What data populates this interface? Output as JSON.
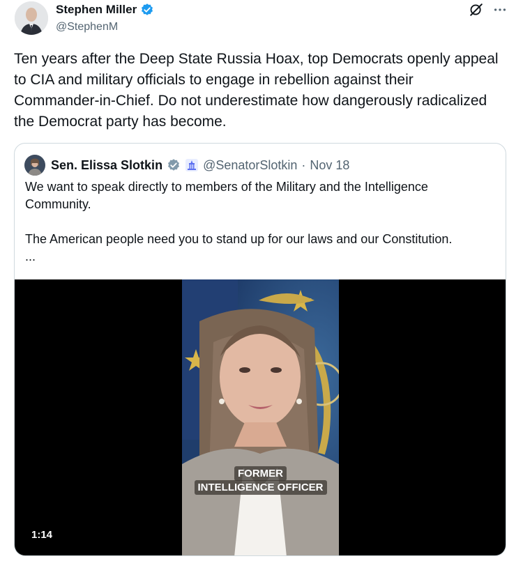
{
  "author": {
    "name": "Stephen Miller",
    "handle": "@StephenM",
    "verified": true,
    "verified_color": "#1d9bf0"
  },
  "header_icons": [
    "grok-icon",
    "more-icon"
  ],
  "post": {
    "text": "Ten years after the Deep State Russia Hoax, top Democrats openly appeal to CIA and military officials to engage in rebellion against their Commander-in-Chief. Do not underestimate how dangerously radicalized the Democrat party has become."
  },
  "quoted_post": {
    "name": "Sen. Elissa Slotkin",
    "handle": "@SenatorSlotkin",
    "separator": "·",
    "date": "Nov 18",
    "verified_badge": "gray-verified-icon",
    "affiliation_badge": "government-building-icon",
    "paragraph1": "We want to speak directly to members of the Military and the Intelligence Community.",
    "paragraph2": "The American people need you to stand up for our laws and our Constitution.",
    "ellipsis": "..."
  },
  "video": {
    "caption_line1": "FORMER",
    "caption_line2": "INTELLIGENCE OFFICER",
    "duration": "1:14"
  },
  "colors": {
    "text": "#0f1419",
    "secondary": "#536471",
    "border": "#cfd9de",
    "verified_blue": "#1d9bf0",
    "verified_gray": "#829aab",
    "video_bg": "#000000"
  }
}
